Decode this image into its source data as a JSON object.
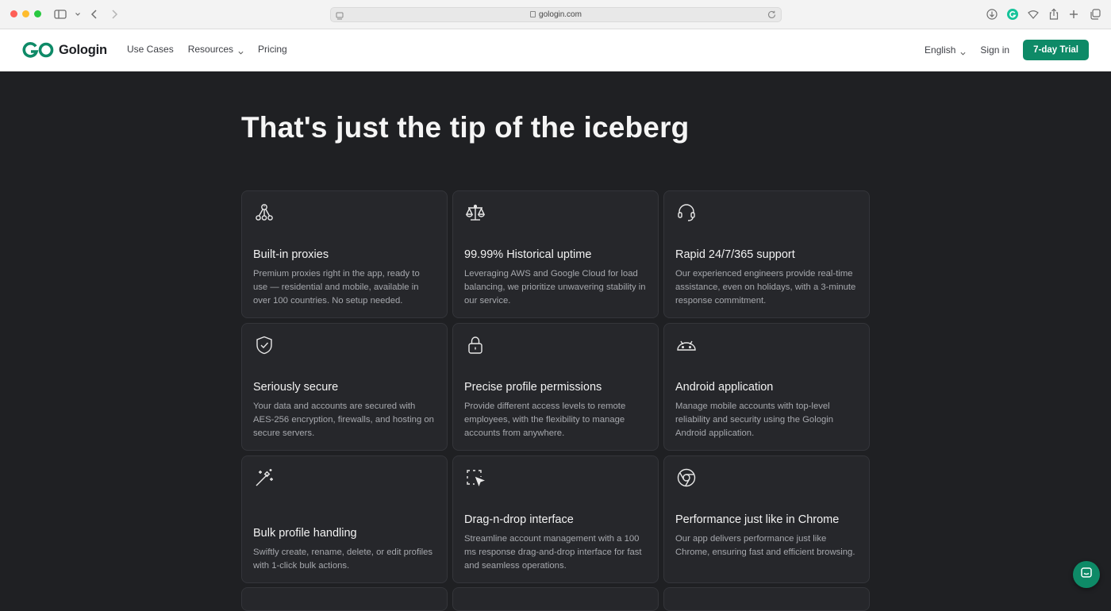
{
  "browser": {
    "url": "gologin.com"
  },
  "header": {
    "logo_text": "Gologin",
    "nav": [
      {
        "label": "Use Cases"
      },
      {
        "label": "Resources"
      },
      {
        "label": "Pricing"
      }
    ],
    "language": "English",
    "sign_in": "Sign in",
    "trial_button": "7-day Trial"
  },
  "main": {
    "headline": "That's just the tip of the iceberg",
    "features": [
      {
        "icon": "proxies-icon",
        "title": "Built-in proxies",
        "description": "Premium proxies right in the app, ready to use — residential and mobile, available in over 100 countries. No setup needed."
      },
      {
        "icon": "scale-icon",
        "title": "99.99% Historical uptime",
        "description": "Leveraging AWS and Google Cloud for load balancing, we prioritize unwavering stability in our service."
      },
      {
        "icon": "headset-icon",
        "title": "Rapid 24/7/365 support",
        "description": "Our experienced engineers provide real-time assistance, even on holidays, with a 3-minute response commitment."
      },
      {
        "icon": "shield-check-icon",
        "title": "Seriously secure",
        "description": "Your data and accounts are secured with AES-256 encryption, firewalls, and hosting on secure servers."
      },
      {
        "icon": "lock-icon",
        "title": "Precise profile permissions",
        "description": "Provide different access levels to remote employees, with the flexibility to manage accounts from anywhere."
      },
      {
        "icon": "android-icon",
        "title": "Android application",
        "description": "Manage mobile accounts with top-level reliability and security using the Gologin Android application."
      },
      {
        "icon": "magic-wand-icon",
        "title": "Bulk profile handling",
        "description": "Swiftly create, rename, delete, or edit profiles with 1-click bulk actions."
      },
      {
        "icon": "drag-select-icon",
        "title": "Drag-n-drop interface",
        "description": "Streamline account management with a 100 ms response drag-and-drop interface for fast and seamless operations."
      },
      {
        "icon": "chrome-icon",
        "title": "Performance just like in Chrome",
        "description": "Our app delivers performance just like Chrome, ensuring fast and efficient browsing."
      }
    ]
  },
  "colors": {
    "brand_green": "#0e8a67",
    "page_dark": "#1f2023",
    "card_bg": "#26272b"
  }
}
